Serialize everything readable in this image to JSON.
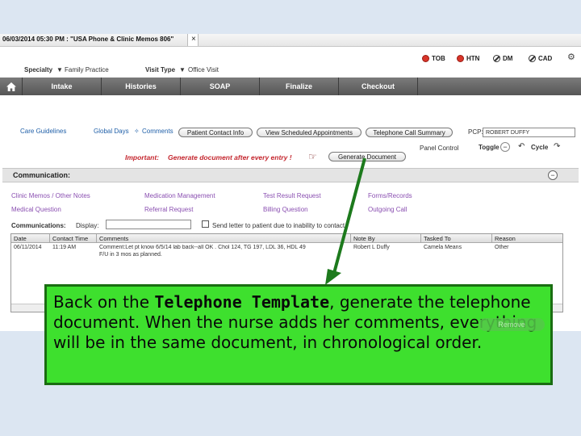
{
  "window": {
    "title": "06/03/2014 05:30 PM : \"USA Phone & Clinic Memos 806\"",
    "close": "×"
  },
  "header": {
    "specialty_label": "Specialty",
    "specialty_value": "Family Practice",
    "visit_type_label": "Visit Type",
    "visit_type_value": "Office Visit",
    "alerts": [
      "TOB",
      "HTN",
      "DM",
      "CAD"
    ]
  },
  "nav": {
    "tabs": [
      "Intake",
      "Histories",
      "SOAP",
      "Finalize",
      "Checkout"
    ]
  },
  "toolbar": {
    "care_guidelines": "Care Guidelines",
    "global_days": "Global Days",
    "comments": "Comments",
    "patient_contact_info": "Patient Contact Info",
    "view_scheduled_appointments": "View Scheduled Appointments",
    "telephone_call_summary": "Telephone Call Summary",
    "pcp_label": "PCP:",
    "pcp_value": "ROBERT DUFFY",
    "panel_control_label": "Panel Control",
    "toggle_label": "Toggle",
    "cycle_label": "Cycle",
    "important_label": "Important:",
    "important_text": "Generate document after every entry !",
    "generate_document": "Generate Document"
  },
  "communication": {
    "section_title": "Communication:",
    "links": [
      "Clinic Memos / Other Notes",
      "Medication Management",
      "Test Result Request",
      "Forms/Records",
      "Medical Question",
      "Referral Request",
      "Billing Question",
      "Outgoing Call"
    ],
    "communications_label": "Communications:",
    "display_label": "Display:",
    "send_letter_label": "Send letter to patient due to inability to contact"
  },
  "grid": {
    "columns": [
      "Date",
      "Contact Time",
      "Comments",
      "Note By",
      "Tasked To",
      "Reason"
    ],
    "rows": [
      {
        "date": "06/11/2014",
        "contact_time": "11:19 AM",
        "comments": "Comment:Let pt know 6/5/14 lab back--all OK . Chol 124, TG 197, LDL 36, HDL 49",
        "comments_line2": "F/U in 3 mos as planned.",
        "note_by": "Robert L Duffy",
        "tasked_to": "Camela Means",
        "reason": "Other"
      }
    ]
  },
  "callout": {
    "text_before": "Back on the ",
    "text_bold": "Telephone Template",
    "text_after": ", generate the telephone document.  When the nurse adds her comments, everything will be in the same document, in chronological order.",
    "remove_button": "Remove"
  },
  "colors": {
    "callout_bg": "#3ee02e",
    "arrow": "#1d7a1d",
    "important_red": "#c4262e",
    "nav_bg": "#5e5e5e"
  }
}
